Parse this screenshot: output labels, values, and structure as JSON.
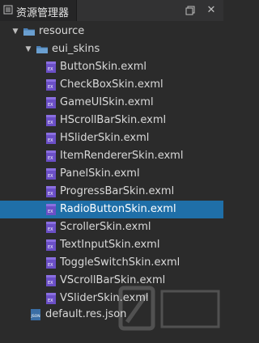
{
  "panel": {
    "title": "资源管理器",
    "restore_icon": "restore-icon",
    "close_icon": "close-icon"
  },
  "tree": {
    "root": {
      "label": "resource",
      "icon": "folder-open-icon",
      "expanded": true
    },
    "subfolder": {
      "label": "eui_skins",
      "icon": "folder-open-icon",
      "expanded": true
    },
    "files": [
      {
        "label": "ButtonSkin.exml"
      },
      {
        "label": "CheckBoxSkin.exml"
      },
      {
        "label": "GameUISkin.exml"
      },
      {
        "label": "HScrollBarSkin.exml"
      },
      {
        "label": "HSliderSkin.exml"
      },
      {
        "label": "ItemRendererSkin.exml"
      },
      {
        "label": "PanelSkin.exml"
      },
      {
        "label": "ProgressBarSkin.exml"
      },
      {
        "label": "RadioButtonSkin.exml",
        "selected": true
      },
      {
        "label": "ScrollerSkin.exml"
      },
      {
        "label": "TextInputSkin.exml"
      },
      {
        "label": "ToggleSwitchSkin.exml"
      },
      {
        "label": "VScrollBarSkin.exml"
      },
      {
        "label": "VSliderSkin.exml"
      }
    ],
    "json_file": {
      "label": "default.res.json",
      "icon": "json-file-icon"
    }
  },
  "colors": {
    "background": "#2b2b2b",
    "selection": "#1f6fa8",
    "exml_icon": "#6b4fc7",
    "folder": "#4a7fb5"
  }
}
